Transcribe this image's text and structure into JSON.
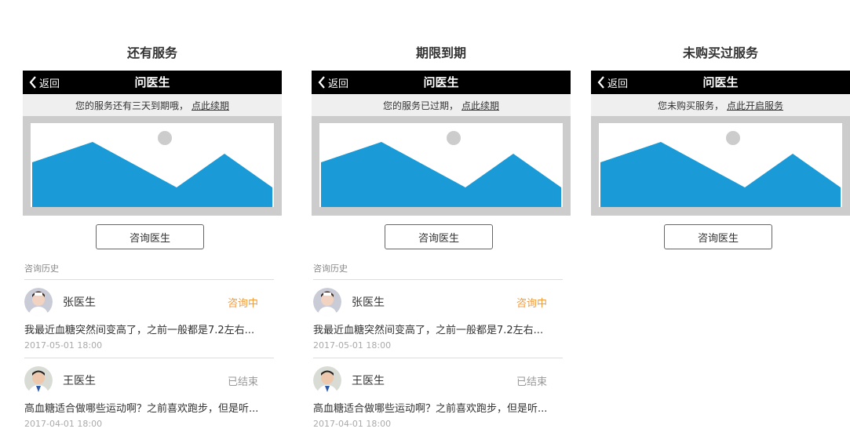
{
  "colors": {
    "navbar_bg": "#000000",
    "image_fill": "#1a9ad6",
    "sun": "#cccccc",
    "status_active": "#f39b3a",
    "status_ended": "#999999"
  },
  "nav": {
    "back_label": "返回",
    "title": "问医生"
  },
  "consult_button_label": "咨询医生",
  "history_label": "咨询历史",
  "variants": [
    {
      "title": "还有服务",
      "notice_text": "您的服务还有三天到期哦，",
      "notice_link": "点此续期"
    },
    {
      "title": "期限到期",
      "notice_text": "您的服务已过期，",
      "notice_link": "点此续期"
    },
    {
      "title": "未购买过服务",
      "notice_text": "您未购买服务，",
      "notice_link": "点此开启服务"
    }
  ],
  "records": [
    {
      "doctor": "张医生",
      "status": "咨询中",
      "message": "我最近血糖突然间变高了，之前一般都是7.2左右...",
      "time": "2017-05-01 18:00"
    },
    {
      "doctor": "王医生",
      "status": "已结束",
      "message": "高血糖适合做哪些运动啊？之前喜欢跑步，但是听...",
      "time": "2017-04-01 18:00"
    }
  ]
}
